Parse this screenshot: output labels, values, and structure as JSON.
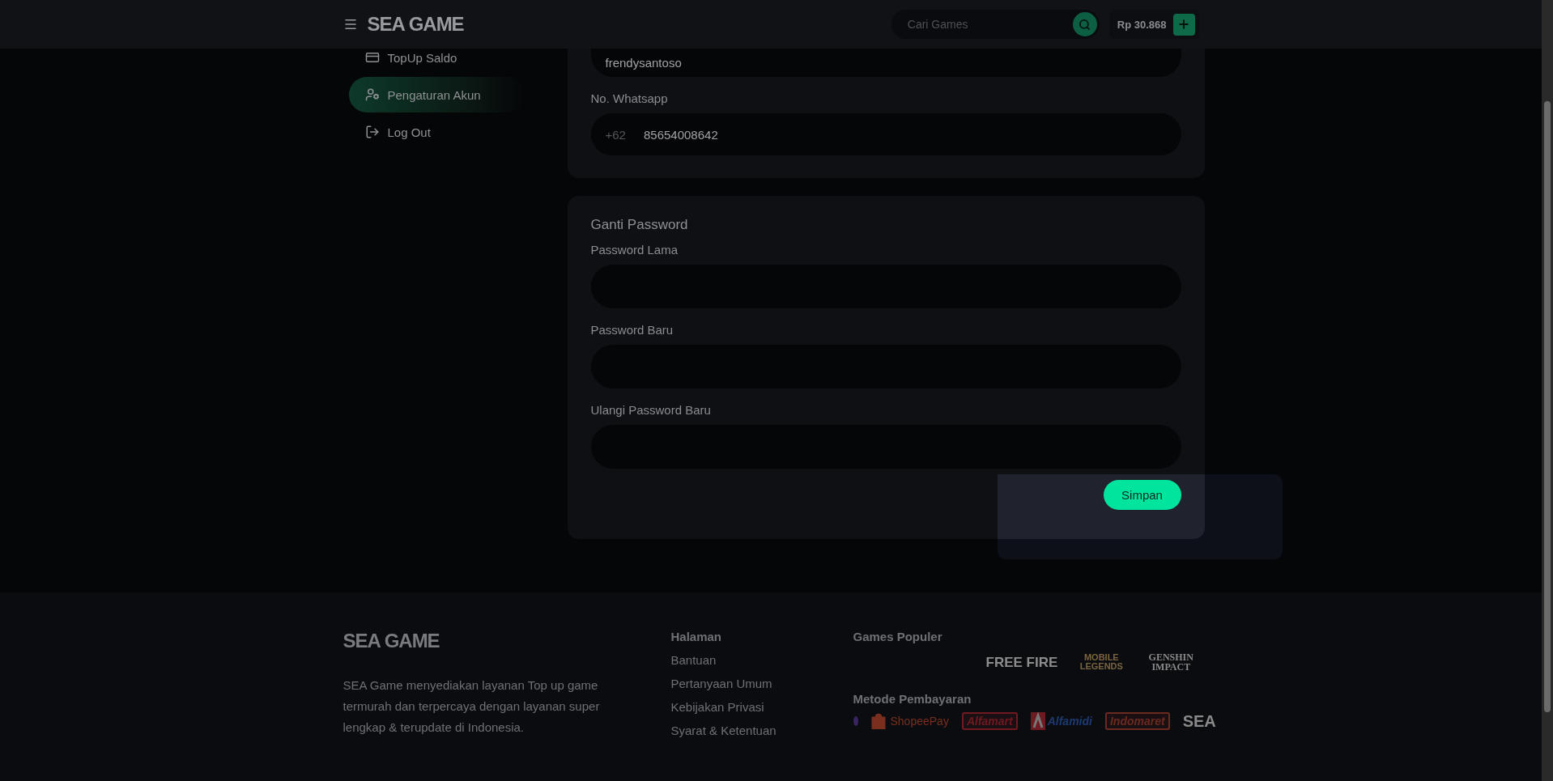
{
  "header": {
    "logo": "SEA GAME",
    "search": {
      "placeholder": "Cari Games"
    },
    "balance": "Rp 30.868"
  },
  "sidebar": {
    "items": [
      {
        "label": "TopUp Saldo",
        "selected": false
      },
      {
        "label": "Pengaturan Akun",
        "selected": true
      },
      {
        "label": "Log Out",
        "selected": false
      }
    ]
  },
  "profile": {
    "username": {
      "value": "frendysantoso"
    },
    "whatsapp": {
      "label": "No. Whatsapp",
      "prefix": "+62",
      "value": "85654008642"
    }
  },
  "password": {
    "title": "Ganti Password",
    "fields": [
      {
        "label": "Password Lama"
      },
      {
        "label": "Password Baru"
      },
      {
        "label": "Ulangi Password Baru"
      }
    ],
    "button": "Simpan"
  },
  "footer": {
    "logo": "SEA GAME",
    "description": "SEA Game menyediakan layanan Top up game termurah dan terpercaya dengan layanan super lengkap & terupdate di Indonesia.",
    "pages": {
      "title": "Halaman",
      "links": [
        "Bantuan",
        "Pertanyaan Umum",
        "Kebijakan Privasi",
        "Syarat & Ketentuan"
      ]
    },
    "games": {
      "title": "Games Populer",
      "logos": [
        {
          "kind": "block",
          "label": "FREE FIRE"
        },
        {
          "kind": "stacked",
          "label": "MOBILE LEGENDS"
        },
        {
          "kind": "serif",
          "label": "GENSHIN IMPACT"
        }
      ]
    },
    "payments": {
      "title": "Metode Pembayaran",
      "logos": [
        {
          "kind": "ring"
        },
        {
          "kind": "bag",
          "label": "ShopeePay"
        },
        {
          "kind": "boxed",
          "label": "Alfamart"
        },
        {
          "kind": "tile",
          "label": "Alfamidi"
        },
        {
          "kind": "boxed",
          "label": "Indomaret"
        },
        {
          "kind": "block",
          "label": "SEA"
        }
      ]
    }
  }
}
